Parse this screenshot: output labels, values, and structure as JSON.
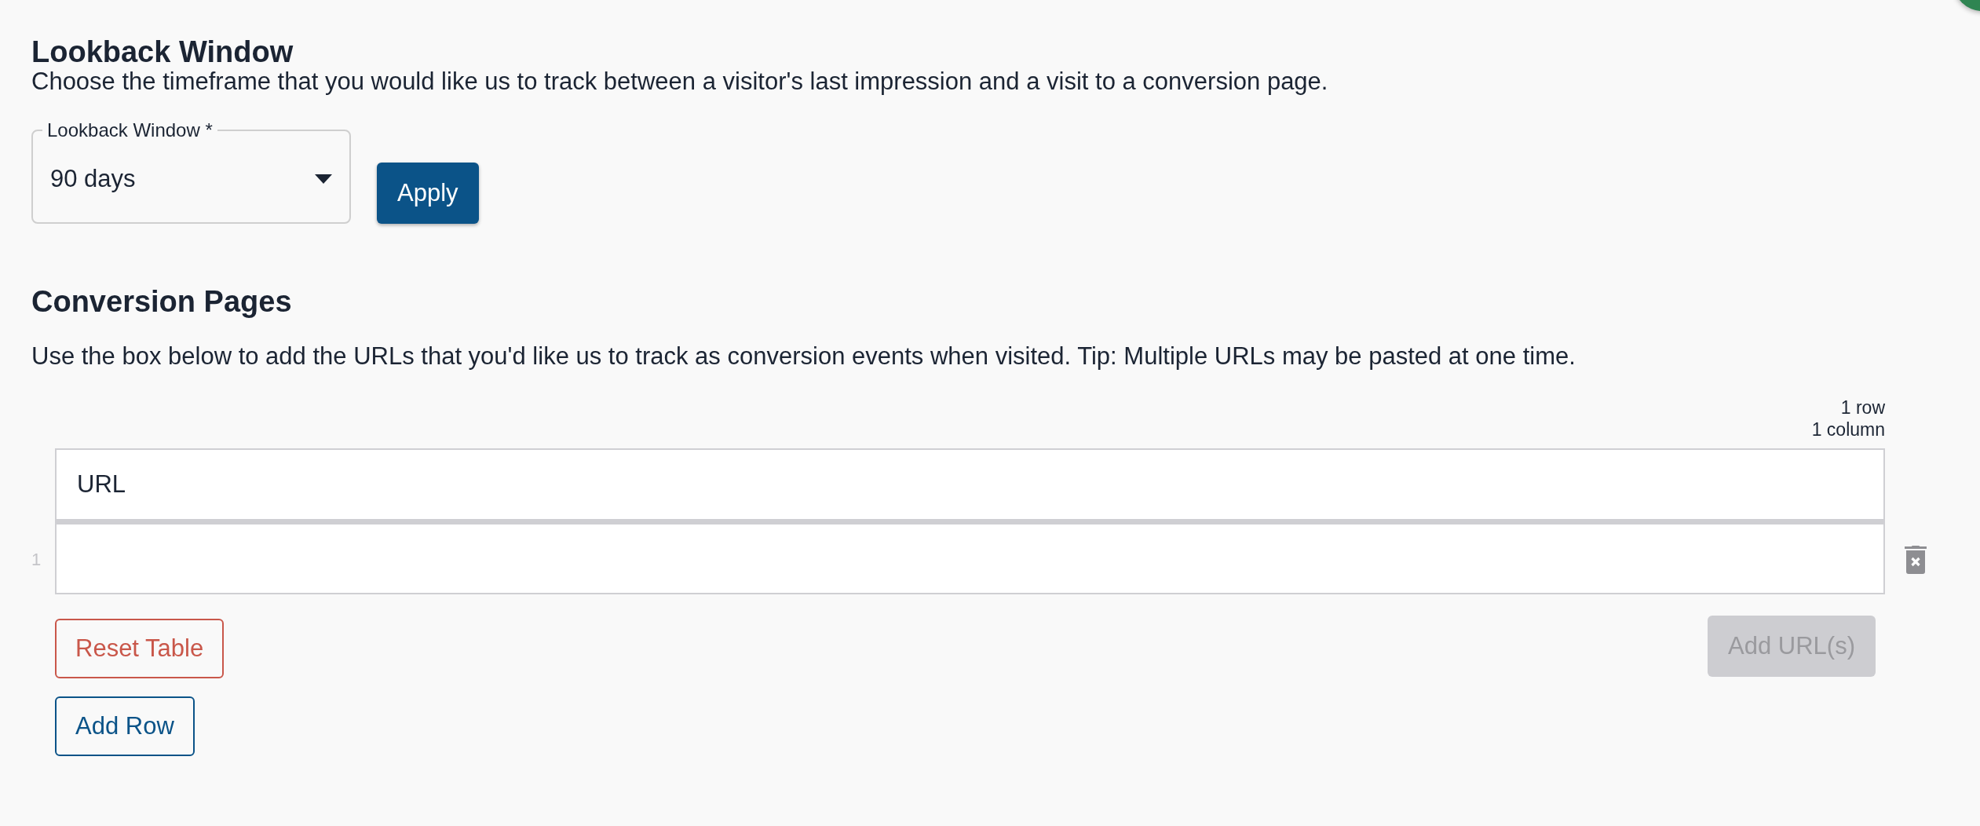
{
  "lookback": {
    "heading": "Lookback Window",
    "description": "Choose the timeframe that you would like us to track between a visitor's last impression and a visit to a conversion page.",
    "select": {
      "label": "Lookback Window *",
      "value": "90 days"
    },
    "apply_button": "Apply"
  },
  "conversion": {
    "heading": "Conversion Pages",
    "description": "Use the box below to add the URLs that you'd like us to track as conversion events when visited. Tip: Multiple URLs may be pasted at one time.",
    "table_info": [
      "1 row",
      "1 column"
    ],
    "table": {
      "columns": [
        "URL"
      ],
      "rows": [
        {
          "row_number": "1"
        }
      ]
    },
    "buttons": [
      {
        "kind": "danger",
        "label": "Reset Table",
        "disabled": false
      },
      {
        "kind": "primary",
        "label": "Add URL(s)",
        "disabled": true
      },
      {
        "kind": "outline",
        "label": "Add Row",
        "disabled": false
      }
    ]
  }
}
